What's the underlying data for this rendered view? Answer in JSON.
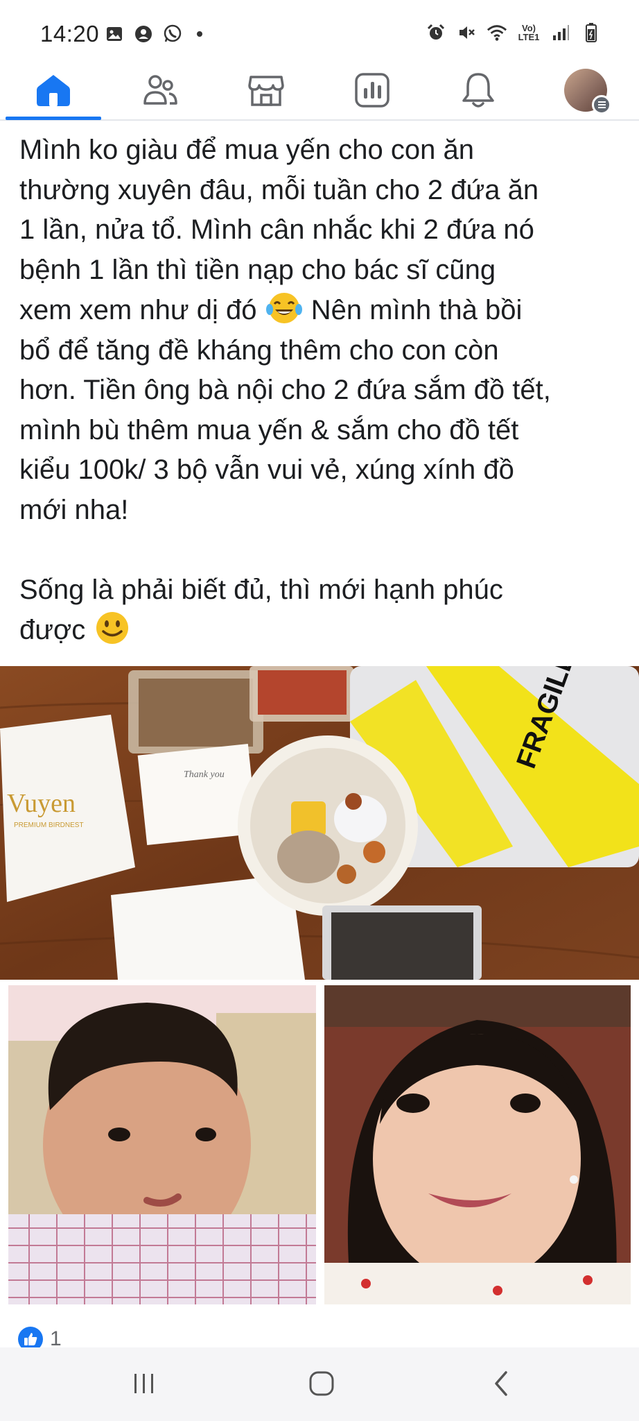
{
  "status_bar": {
    "time": "14:20",
    "left_icons": [
      "gallery-icon",
      "account-icon",
      "whatsapp-icon",
      "dot-icon"
    ],
    "right_icons": [
      "alarm-icon",
      "mute-icon",
      "wifi-icon",
      "volte-icon",
      "signal-icon",
      "battery-icon"
    ],
    "volte_label_top": "Vo)",
    "volte_label_bottom": "LTE1"
  },
  "nav": {
    "items": [
      {
        "name": "home",
        "icon": "home-icon",
        "active": true
      },
      {
        "name": "friends",
        "icon": "friends-icon",
        "active": false
      },
      {
        "name": "marketplace",
        "icon": "marketplace-icon",
        "active": false
      },
      {
        "name": "dashboard",
        "icon": "dashboard-icon",
        "active": false
      },
      {
        "name": "notifications",
        "icon": "bell-icon",
        "active": false
      },
      {
        "name": "profile",
        "icon": "avatar-icon",
        "active": false
      }
    ],
    "accent_color": "#1877f2"
  },
  "post": {
    "paragraph1": [
      "Mình ko giàu để mua yến cho con ăn",
      "thường xuyên đâu, mỗi tuần cho 2 đứa ăn",
      "1 lần, nửa tổ. Mình cân nhắc khi 2 đứa nó",
      "bệnh 1 lần thì tiền nạp cho bác sĩ cũng",
      "xem xem như dị đó",
      "Nên mình thà bồi",
      "bổ để tăng đề kháng thêm cho con còn",
      "hơn. Tiền ông bà nội cho 2 đứa sắm đồ tết,",
      "mình bù thêm mua yến & sắm cho đồ tết",
      "kiểu 100k/ 3 bộ vẫn vui vẻ, xúng xính đồ",
      "mới nha!"
    ],
    "paragraph2": [
      "Sống là phải biết đủ, thì mới hạnh phúc",
      "được"
    ],
    "emoji_1": "tears-of-joy-emoji",
    "emoji_2": "smile-emoji",
    "photo_brand": "Vuyen",
    "photo_brand_sub": "PREMIUM BIRDNEST",
    "photo_card_text": "Thank you",
    "photo_tape_text": "FRAGILE",
    "reactions": {
      "icon": "like-icon",
      "count": "1"
    }
  },
  "android_nav": {
    "buttons": [
      "recents-icon",
      "home-button-icon",
      "back-icon"
    ]
  }
}
